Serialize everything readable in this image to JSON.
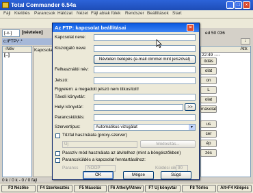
{
  "app": {
    "title": "Total Commander 6.54a",
    "menu": [
      "Fájl",
      "Kielölés",
      "Parancsok",
      "Hálózat",
      "Nézet",
      "Fájl ablak fülek",
      "Rendszer",
      "Beállítások",
      "Start"
    ]
  },
  "left": {
    "drive": "[-c-]",
    "label": "[névtelen]",
    "path": "c:\\FTP\\*.*",
    "col": "↑Név",
    "row": "[..]",
    "side": "Kapcsolat",
    "status": "0 k / 0 k - 0 / 0 fájl"
  },
  "right": {
    "info": "ed  50 036",
    "attr": "Attr.",
    "row": "22:49 ----"
  },
  "rbtns": [
    "ódás",
    "olat",
    "on",
    "L",
    "olat",
    "másolat",
    "us",
    "cer",
    "ép",
    "zés"
  ],
  "dialog": {
    "title": "Az FTP: kapcsolat beállításai",
    "conn_name": "Kapcsolat neve:",
    "host": "Kiszolgáló neve:",
    "anon_btn": "Névtelen belépés (e-mail címmel mint jelszóval)",
    "user": "Felhasználói név:",
    "pwd": "Jelszó:",
    "warn": "Figyelem: a megadott jelszó nem titkosított!",
    "remote": "Távoli könyvtár:",
    "local": "Helyi könyvtár:",
    "browse": ">>",
    "cmd": "Parancsküldés:",
    "server_type": "Szervertípus:",
    "server_val": "Automatikus vizsgálat",
    "firewall": "Tűzfal használata (proxy-szerver)",
    "proxy_val": "Új",
    "modify": "Módosítás...",
    "passive": "Passzív mód használata az átvitelhez (mint a böngészőkben)",
    "keepalive": "Parancsküldés a kapcsolat fenntartásához:",
    "ka_type": "Parancs",
    "ka_val": "NOOP",
    "interval": "Küldési ciklus:",
    "interval_val": "90",
    "ok": "OK",
    "cancel": "Mégse",
    "help": "Súgó"
  },
  "fkeys": [
    "F3 Nézőke",
    "F4 Szerkesztés",
    "F5 Másolás",
    "F6 Áthely/Átnev",
    "F7 Új könyvtár",
    "F8 Törlés",
    "Alt+F4 Kilépés"
  ]
}
